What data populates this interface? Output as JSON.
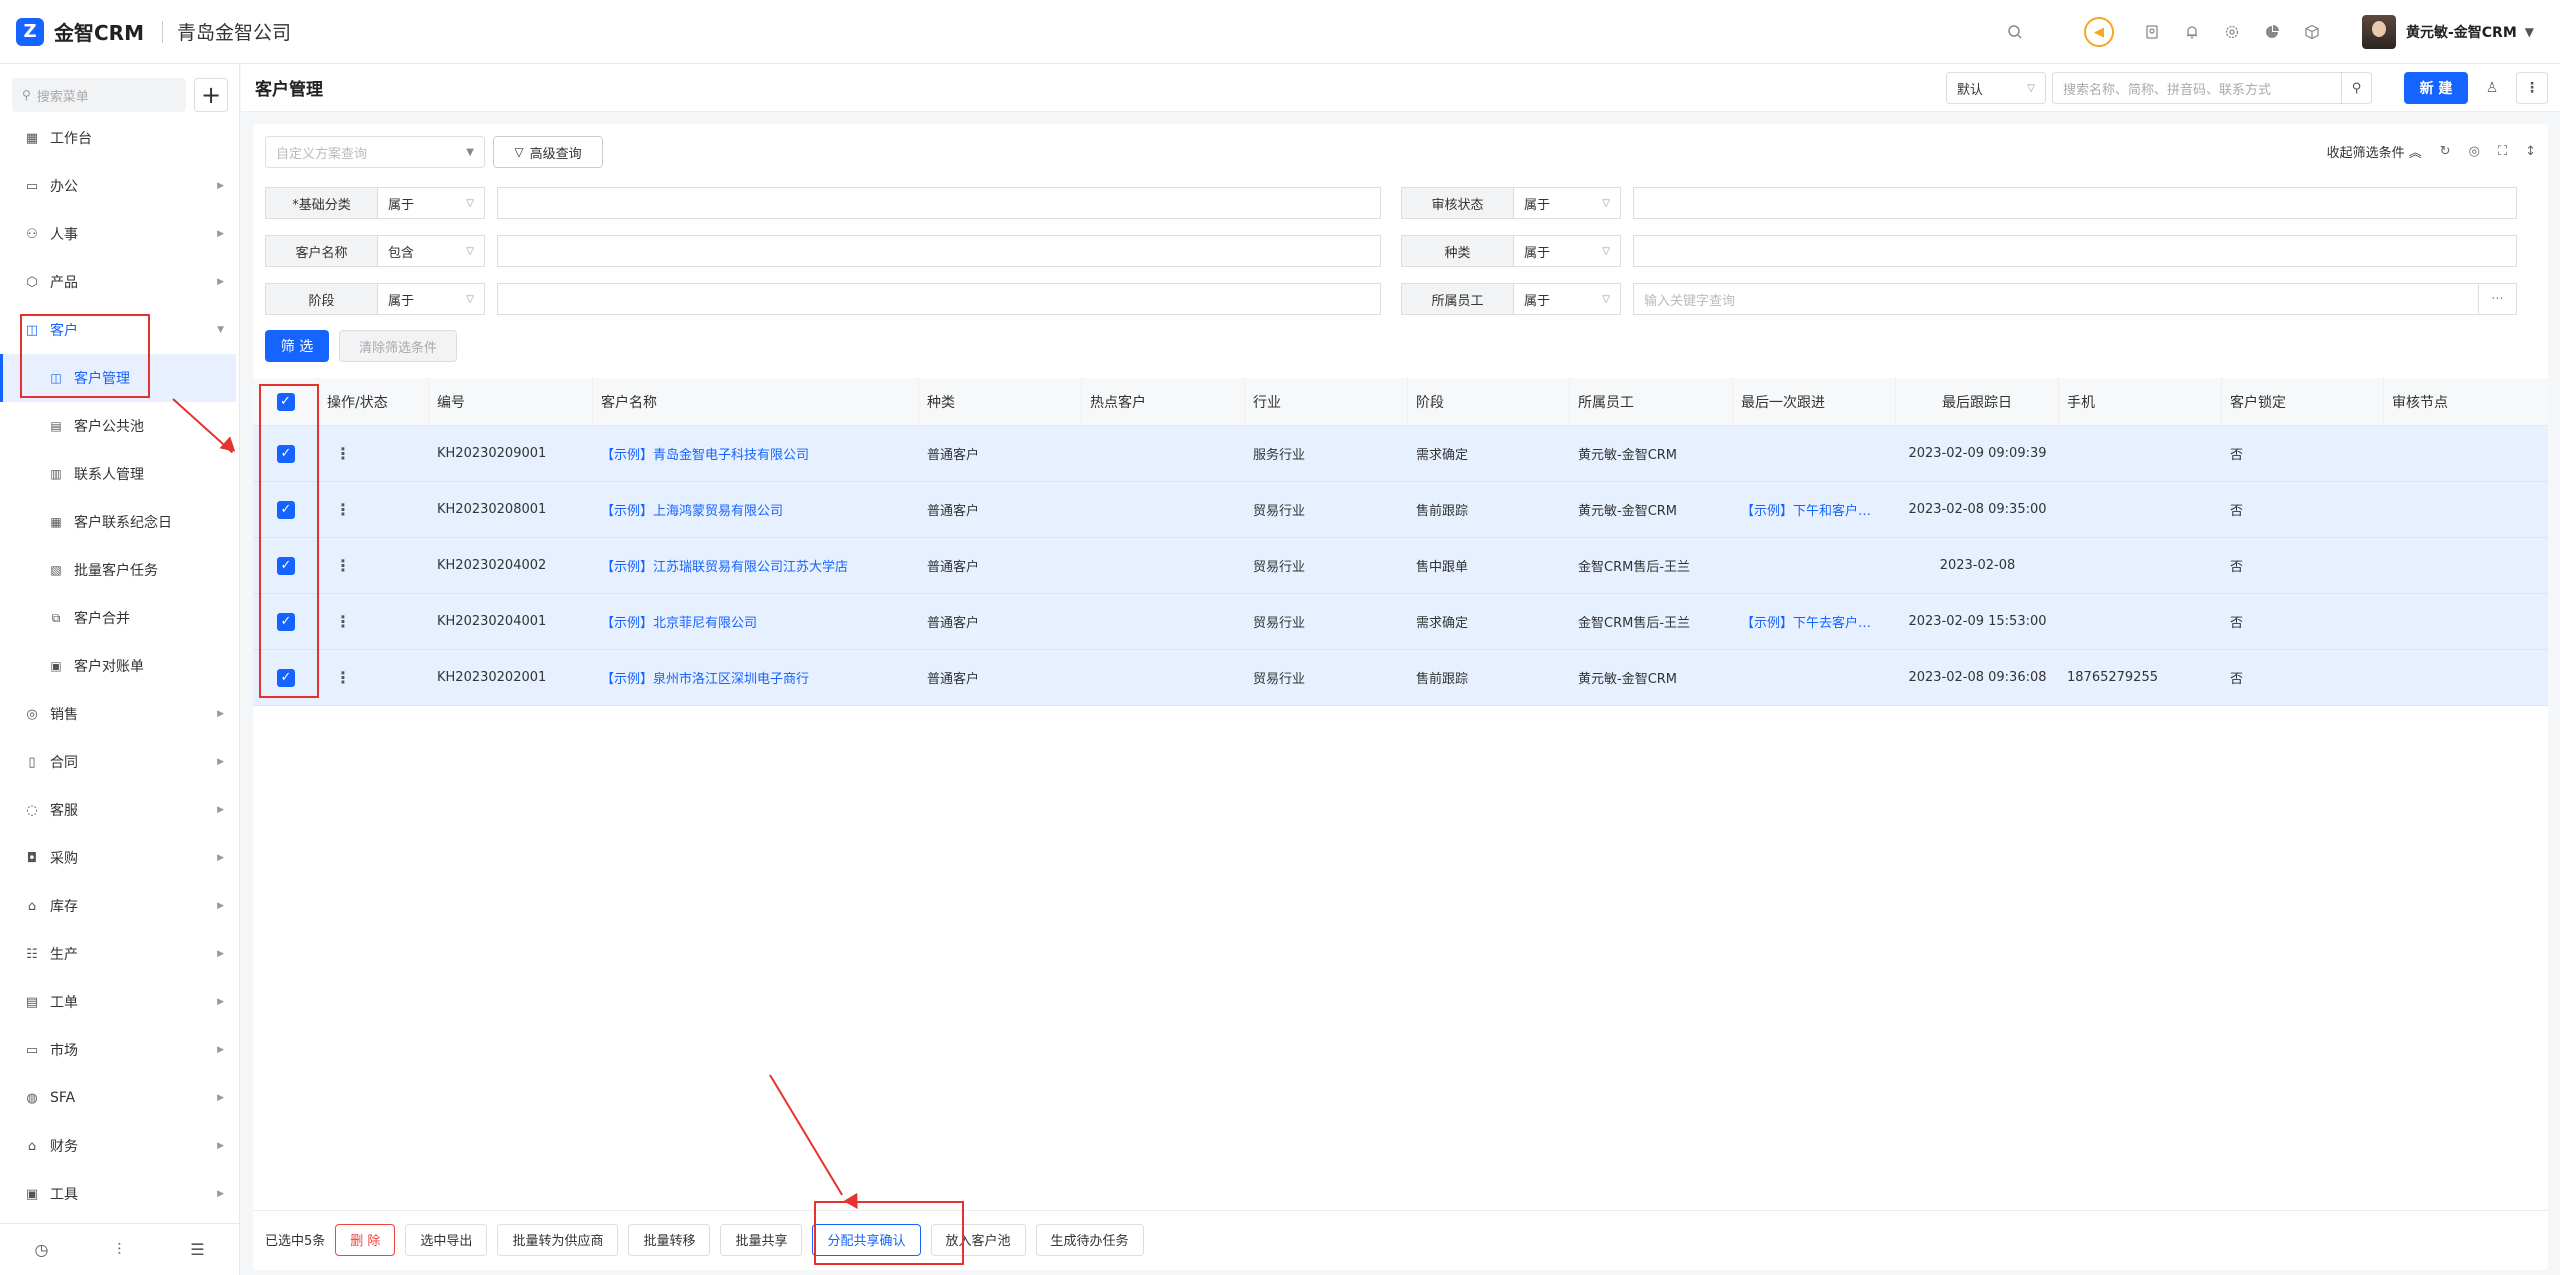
{
  "app": {
    "logo_mark": "Z",
    "name": "金智CRM",
    "company": "青岛金智公司"
  },
  "topbar": {
    "user_name": "黄元敏-金智CRM",
    "icons": [
      "search-icon",
      "megaphone-icon",
      "contacts-icon",
      "bell-icon",
      "gear-icon",
      "pie-chart-icon",
      "cube-icon"
    ]
  },
  "sidebar": {
    "search_placeholder": "搜索菜单",
    "add_label": "+",
    "items": [
      {
        "label": "工作台",
        "icon": "dashboard-icon",
        "has_arrow": false
      },
      {
        "label": "办公",
        "icon": "office-icon",
        "has_arrow": true
      },
      {
        "label": "人事",
        "icon": "people-icon",
        "has_arrow": true
      },
      {
        "label": "产品",
        "icon": "product-icon",
        "has_arrow": true
      },
      {
        "label": "客户",
        "icon": "customer-icon",
        "has_arrow": true,
        "expanded": true
      }
    ],
    "sub_items": [
      {
        "label": "客户管理",
        "active": true
      },
      {
        "label": "客户公共池"
      },
      {
        "label": "联系人管理"
      },
      {
        "label": "客户联系纪念日"
      },
      {
        "label": "批量客户任务"
      },
      {
        "label": "客户合并"
      },
      {
        "label": "客户对账单"
      }
    ],
    "items_after": [
      {
        "label": "销售"
      },
      {
        "label": "合同"
      },
      {
        "label": "客服"
      },
      {
        "label": "采购"
      },
      {
        "label": "库存"
      },
      {
        "label": "生产"
      },
      {
        "label": "工单"
      },
      {
        "label": "市场"
      },
      {
        "label": "SFA"
      },
      {
        "label": "财务"
      },
      {
        "label": "工具"
      }
    ]
  },
  "page": {
    "title": "客户管理",
    "view_select": "默认",
    "search_placeholder": "搜索名称、简称、拼音码、联系方式",
    "new_label": "新 建"
  },
  "filters": {
    "scheme_placeholder": "自定义方案查询",
    "advanced_label": "高级查询",
    "collapse_label": "收起筛选条件",
    "rows": [
      {
        "label": "*基础分类",
        "op": "属于",
        "value": ""
      },
      {
        "label": "审核状态",
        "op": "属于",
        "value": ""
      },
      {
        "label": "客户名称",
        "op": "包含",
        "value": ""
      },
      {
        "label": "种类",
        "op": "属于",
        "value": ""
      },
      {
        "label": "阶段",
        "op": "属于",
        "value": ""
      },
      {
        "label": "所属员工",
        "op": "属于",
        "value": ""
      }
    ],
    "employee_placeholder": "输入关键字查询",
    "filter_btn": "筛 选",
    "clear_btn": "清除筛选条件"
  },
  "table": {
    "columns": [
      "操作/状态",
      "编号",
      "客户名称",
      "种类",
      "热点客户",
      "行业",
      "阶段",
      "所属员工",
      "最后一次跟进",
      "最后跟踪日",
      "手机",
      "客户锁定",
      "审核节点"
    ],
    "rows": [
      {
        "code": "KH20230209001",
        "name": "【示例】青岛金智电子科技有限公司",
        "kind": "普通客户",
        "hot": "",
        "industry": "服务行业",
        "stage": "需求确定",
        "owner": "黄元敏-金智CRM",
        "last_follow": "",
        "last_date": "2023-02-09 09:09:39",
        "phone": "",
        "locked": "否",
        "audit": ""
      },
      {
        "code": "KH20230208001",
        "name": "【示例】上海鸿蒙贸易有限公司",
        "kind": "普通客户",
        "hot": "",
        "industry": "贸易行业",
        "stage": "售前跟踪",
        "owner": "黄元敏-金智CRM",
        "last_follow": "【示例】下午和客户…",
        "last_date": "2023-02-08 09:35:00",
        "phone": "",
        "locked": "否",
        "audit": ""
      },
      {
        "code": "KH20230204002",
        "name": "【示例】江苏瑞联贸易有限公司江苏大学店",
        "kind": "普通客户",
        "hot": "",
        "industry": "贸易行业",
        "stage": "售中跟单",
        "owner": "金智CRM售后-王兰",
        "last_follow": "",
        "last_date": "2023-02-08",
        "phone": "",
        "locked": "否",
        "audit": ""
      },
      {
        "code": "KH20230204001",
        "name": "【示例】北京菲尼有限公司",
        "kind": "普通客户",
        "hot": "",
        "industry": "贸易行业",
        "stage": "需求确定",
        "owner": "金智CRM售后-王兰",
        "last_follow": "【示例】下午去客户…",
        "last_date": "2023-02-09 15:53:00",
        "phone": "",
        "locked": "否",
        "audit": ""
      },
      {
        "code": "KH20230202001",
        "name": "【示例】泉州市洛江区深圳电子商行",
        "kind": "普通客户",
        "hot": "",
        "industry": "贸易行业",
        "stage": "售前跟踪",
        "owner": "黄元敏-金智CRM",
        "last_follow": "",
        "last_date": "2023-02-08 09:36:08",
        "phone": "18765279255",
        "locked": "否",
        "audit": ""
      }
    ]
  },
  "bottom_bar": {
    "selected_text": "已选中5条",
    "buttons": [
      "删 除",
      "选中导出",
      "批量转为供应商",
      "批量转移",
      "批量共享",
      "分配共享确认",
      "放入客户池",
      "生成待办任务"
    ]
  }
}
